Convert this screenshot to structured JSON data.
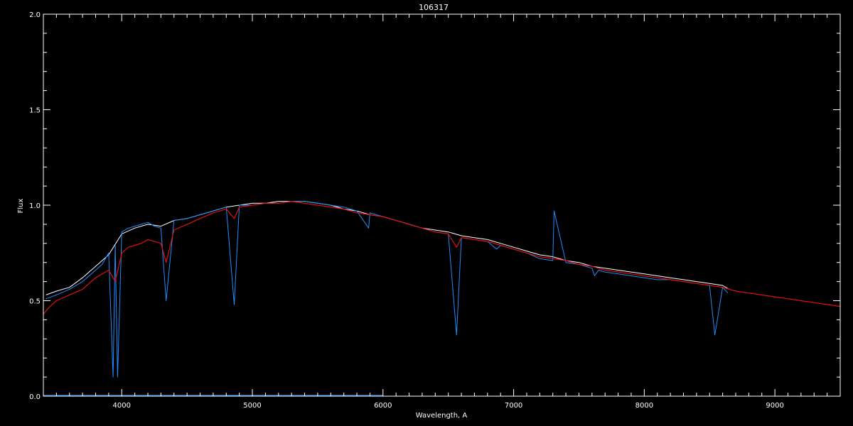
{
  "chart_data": {
    "type": "line",
    "title": "106317",
    "xlabel": "Wavelength, A",
    "ylabel": "Flux",
    "xlim": [
      3400,
      9500
    ],
    "ylim": [
      0.0,
      2.0
    ],
    "xticks": [
      4000,
      5000,
      6000,
      7000,
      8000,
      9000
    ],
    "xtick_labels": [
      "4000",
      "5000",
      "6000",
      "7000",
      "8000",
      "9000"
    ],
    "yticks": [
      0.0,
      0.5,
      1.0,
      1.5,
      2.0
    ],
    "ytick_labels": [
      "0.0",
      "0.5",
      "1.0",
      "1.5",
      "2.0"
    ],
    "grid": false,
    "colors": {
      "background": "#000000",
      "axes": "#ffffff",
      "white_series": "#ffffff",
      "blue_series": "#1e8fff",
      "red_series": "#e01010"
    },
    "series": [
      {
        "color": "white",
        "x": [
          3420,
          3500,
          3600,
          3700,
          3800,
          3900,
          4000,
          4100,
          4200,
          4300,
          4400,
          4500,
          4600,
          4700,
          4800,
          4900,
          5000,
          5100,
          5200,
          5300,
          5400,
          5500,
          5600,
          5700,
          5800,
          5900,
          6000,
          6100,
          6200,
          6300,
          6400,
          6500,
          6600,
          6700,
          6800,
          6900,
          7000,
          7100,
          7200,
          7300,
          7400,
          7500,
          7600,
          7700,
          7800,
          7900,
          8000,
          8100,
          8200,
          8300,
          8400,
          8500,
          8600,
          8650
        ],
        "y": [
          0.53,
          0.55,
          0.57,
          0.62,
          0.68,
          0.74,
          0.85,
          0.88,
          0.9,
          0.89,
          0.92,
          0.93,
          0.95,
          0.97,
          0.99,
          1.0,
          1.01,
          1.01,
          1.02,
          1.02,
          1.02,
          1.01,
          1.0,
          0.98,
          0.97,
          0.95,
          0.94,
          0.92,
          0.9,
          0.88,
          0.87,
          0.86,
          0.84,
          0.83,
          0.82,
          0.8,
          0.78,
          0.76,
          0.74,
          0.73,
          0.71,
          0.7,
          0.68,
          0.67,
          0.66,
          0.65,
          0.64,
          0.63,
          0.62,
          0.61,
          0.6,
          0.59,
          0.58,
          0.56
        ]
      },
      {
        "color": "blue",
        "x": [
          3420,
          3500,
          3600,
          3700,
          3800,
          3850,
          3900,
          3934,
          3950,
          3968,
          4000,
          4050,
          4100,
          4150,
          4200,
          4250,
          4300,
          4340,
          4400,
          4500,
          4600,
          4700,
          4800,
          4861,
          4900,
          5000,
          5100,
          5200,
          5300,
          5400,
          5500,
          5600,
          5700,
          5800,
          5890,
          5900,
          6000,
          6100,
          6200,
          6300,
          6400,
          6500,
          6563,
          6600,
          6700,
          6800,
          6870,
          6900,
          7000,
          7100,
          7200,
          7300,
          7310,
          7400,
          7500,
          7600,
          7620,
          7650,
          7700,
          7800,
          7900,
          8000,
          8100,
          8200,
          8300,
          8400,
          8500,
          8540,
          8600,
          8640
        ],
        "y": [
          0.51,
          0.53,
          0.56,
          0.6,
          0.66,
          0.69,
          0.75,
          0.1,
          0.79,
          0.1,
          0.86,
          0.88,
          0.89,
          0.9,
          0.91,
          0.89,
          0.88,
          0.5,
          0.92,
          0.93,
          0.95,
          0.97,
          0.99,
          0.48,
          1.0,
          1.0,
          1.01,
          1.01,
          1.02,
          1.02,
          1.01,
          1.0,
          0.99,
          0.97,
          0.88,
          0.96,
          0.94,
          0.92,
          0.9,
          0.88,
          0.86,
          0.85,
          0.32,
          0.83,
          0.82,
          0.81,
          0.77,
          0.79,
          0.77,
          0.75,
          0.72,
          0.71,
          0.97,
          0.7,
          0.69,
          0.67,
          0.63,
          0.66,
          0.65,
          0.64,
          0.63,
          0.62,
          0.61,
          0.61,
          0.6,
          0.59,
          0.58,
          0.32,
          0.57,
          0.54
        ]
      },
      {
        "color": "red",
        "x": [
          3400,
          3450,
          3500,
          3600,
          3700,
          3800,
          3900,
          3950,
          4000,
          4050,
          4100,
          4150,
          4200,
          4250,
          4300,
          4340,
          4400,
          4500,
          4600,
          4700,
          4800,
          4861,
          4900,
          5000,
          5100,
          5200,
          5300,
          5400,
          5500,
          5600,
          5700,
          5800,
          5900,
          6000,
          6100,
          6200,
          6300,
          6400,
          6500,
          6563,
          6600,
          6700,
          6800,
          6900,
          7000,
          7100,
          7200,
          7300,
          7400,
          7500,
          7600,
          7700,
          7800,
          7900,
          8000,
          8100,
          8200,
          8300,
          8400,
          8500,
          8600,
          8700,
          8800,
          8900,
          9000,
          9100,
          9200,
          9300,
          9400,
          9500
        ],
        "y": [
          0.43,
          0.47,
          0.5,
          0.53,
          0.56,
          0.62,
          0.66,
          0.6,
          0.75,
          0.78,
          0.79,
          0.8,
          0.82,
          0.81,
          0.8,
          0.7,
          0.87,
          0.9,
          0.93,
          0.96,
          0.98,
          0.93,
          0.99,
          1.0,
          1.01,
          1.01,
          1.02,
          1.01,
          1.0,
          0.99,
          0.98,
          0.96,
          0.95,
          0.94,
          0.92,
          0.9,
          0.88,
          0.86,
          0.85,
          0.78,
          0.83,
          0.82,
          0.81,
          0.79,
          0.77,
          0.75,
          0.73,
          0.72,
          0.71,
          0.69,
          0.68,
          0.66,
          0.65,
          0.64,
          0.63,
          0.62,
          0.61,
          0.6,
          0.59,
          0.58,
          0.57,
          0.55,
          0.54,
          0.53,
          0.52,
          0.51,
          0.5,
          0.49,
          0.48,
          0.47
        ]
      },
      {
        "color": "blue",
        "x": [
          3400,
          5000,
          6000
        ],
        "y": [
          0.005,
          0.005,
          0.005
        ]
      }
    ]
  }
}
